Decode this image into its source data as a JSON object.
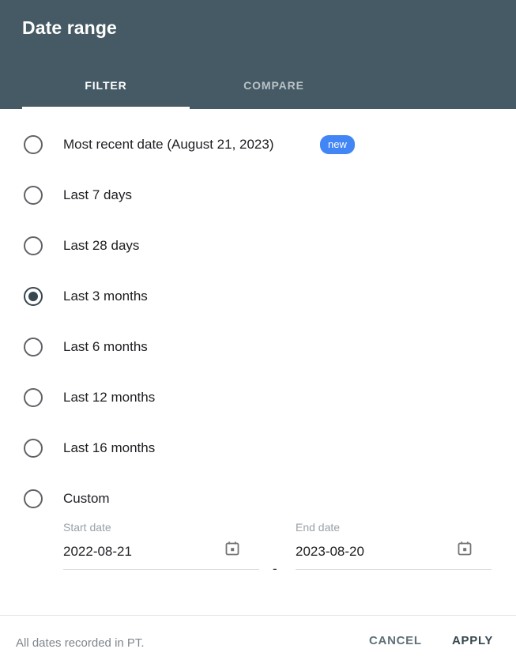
{
  "header": {
    "title": "Date range",
    "bg_color": "#455a64",
    "tabs": [
      {
        "label": "FILTER",
        "active": true
      },
      {
        "label": "COMPARE",
        "active": false
      }
    ]
  },
  "options": [
    {
      "label": "Most recent date (August 21, 2023)",
      "selected": false,
      "badge": "new",
      "badge_color": "#4285f4",
      "name": "most-recent-date"
    },
    {
      "label": "Last 7 days",
      "selected": false,
      "name": "last-7-days"
    },
    {
      "label": "Last 28 days",
      "selected": false,
      "name": "last-28-days"
    },
    {
      "label": "Last 3 months",
      "selected": true,
      "name": "last-3-months"
    },
    {
      "label": "Last 6 months",
      "selected": false,
      "name": "last-6-months"
    },
    {
      "label": "Last 12 months",
      "selected": false,
      "name": "last-12-months"
    },
    {
      "label": "Last 16 months",
      "selected": false,
      "name": "last-16-months"
    },
    {
      "label": "Custom",
      "selected": false,
      "name": "custom"
    }
  ],
  "custom_range": {
    "start": {
      "label": "Start date",
      "value": "2022-08-21",
      "icon": "calendar-icon"
    },
    "end": {
      "label": "End date",
      "value": "2023-08-20",
      "icon": "calendar-icon"
    },
    "separator": "-"
  },
  "footer": {
    "note": "All dates recorded in PT.",
    "cancel_label": "CANCEL",
    "apply_label": "APPLY"
  }
}
